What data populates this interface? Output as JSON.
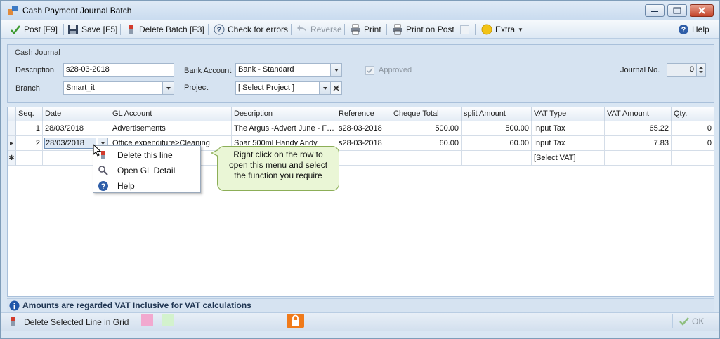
{
  "window": {
    "title": "Cash Payment Journal Batch"
  },
  "toolbar": {
    "post_label": "Post [F9]",
    "save_label": "Save [F5]",
    "delete_label": "Delete Batch [F3]",
    "check_label": "Check for errors",
    "reverse_label": "Reverse",
    "print_label": "Print",
    "print_on_post_label": "Print on Post",
    "extra_label": "Extra",
    "help_label": "Help"
  },
  "journal": {
    "section_title": "Cash Journal",
    "description_label": "Description",
    "description_value": "s28-03-2018",
    "branch_label": "Branch",
    "branch_value": "Smart_it",
    "bank_account_label": "Bank Account",
    "bank_account_value": "Bank - Standard",
    "project_label": "Project",
    "project_value": "[ Select Project ]",
    "approved_label": "Approved",
    "journal_no_label": "Journal No.",
    "journal_no_value": "0"
  },
  "grid": {
    "columns": [
      "Seq.",
      "Date",
      "GL Account",
      "Description",
      "Reference",
      "Cheque Total",
      "split Amount",
      "VAT Type",
      "VAT Amount",
      "Qty."
    ],
    "rows": [
      {
        "indicator": "",
        "seq": "1",
        "date": "28/03/2018",
        "gl": "Advertisements",
        "desc": "The Argus -Advert June - F…",
        "ref": "s28-03-2018",
        "cheque": "500.00",
        "split": "500.00",
        "vat_type": "Input Tax",
        "vat_amount": "65.22",
        "qty": "0"
      },
      {
        "indicator": "▸",
        "seq": "2",
        "date": "28/03/2018",
        "gl": "Office expenditure>Cleaning",
        "desc": "Spar 500ml Handy Andy",
        "ref": "s28-03-2018",
        "cheque": "60.00",
        "split": "60.00",
        "vat_type": "Input Tax",
        "vat_amount": "7.83",
        "qty": "0"
      },
      {
        "indicator": "✱",
        "seq": "",
        "date": "",
        "gl": "",
        "desc": "",
        "ref": "",
        "cheque": "",
        "split": "",
        "vat_type": "[Select VAT]",
        "vat_amount": "",
        "qty": ""
      }
    ]
  },
  "context_menu": {
    "items": [
      {
        "label": "Delete this line"
      },
      {
        "label": "Open GL Detail"
      },
      {
        "label": "Help"
      }
    ]
  },
  "callout": {
    "lines": [
      "Right click on the row to",
      "open this menu and select",
      "the function you require"
    ]
  },
  "info": {
    "text": "Amounts are regarded VAT Inclusive for VAT calculations"
  },
  "status": {
    "text": "Delete Selected Line in Grid",
    "swatch_pink": "#f2a9cf",
    "swatch_green": "#d3f2cd",
    "ok_label": "OK"
  }
}
